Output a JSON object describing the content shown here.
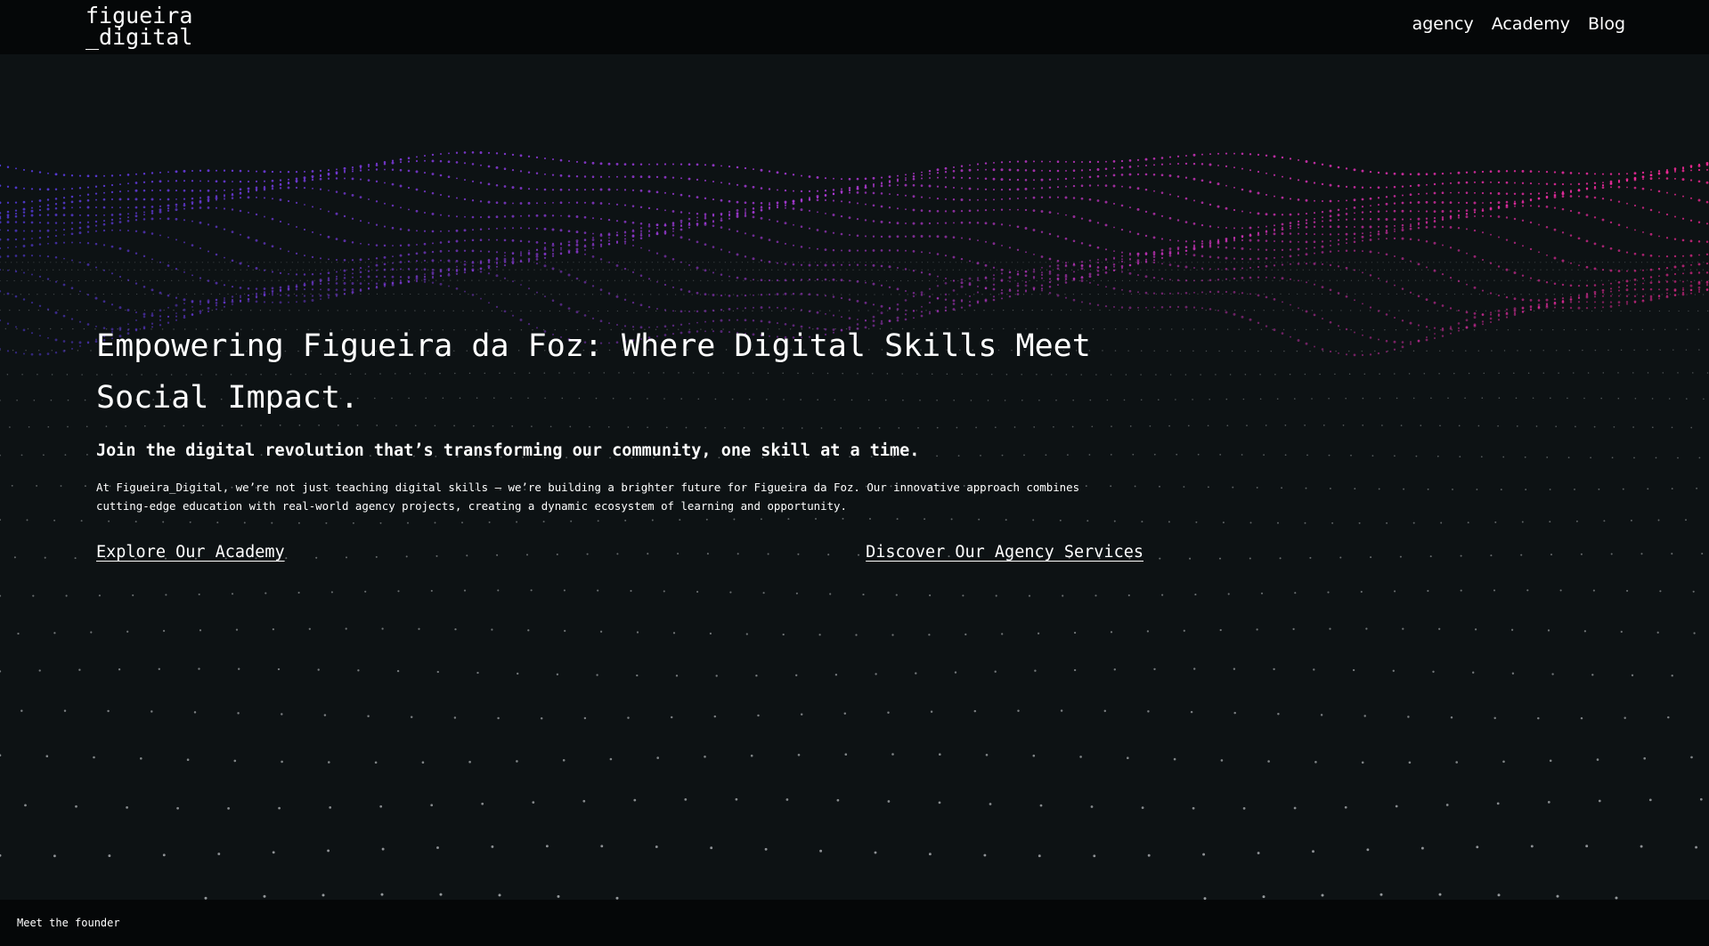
{
  "header": {
    "logo_line1": "figueira",
    "logo_line2": "_digital",
    "nav": [
      "agency",
      "Academy",
      "Blog"
    ]
  },
  "hero": {
    "title": "Empowering Figueira da Foz: Where Digital Skills Meet Social Impact.",
    "subtitle": "Join the digital revolution that’s transforming our community, one skill at a time.",
    "body": "At Figueira_Digital, we’re not just teaching digital skills – we’re building a brighter future for Figueira da Foz. Our innovative approach combines cutting-edge education with real-world agency projects, creating a dynamic ecosystem of learning and opportunity.",
    "academy_link": "Explore Our Academy",
    "agency_link": "Discover Our Agency Services"
  },
  "footer": {
    "founder_link": "Meet the founder"
  },
  "colors": {
    "background": "#0d1214",
    "bar": "#050708",
    "wave_left": "#5b3ef0",
    "wave_mid": "#b23ad8",
    "wave_right": "#ff2a9a",
    "dots": "#cfd3d6"
  }
}
